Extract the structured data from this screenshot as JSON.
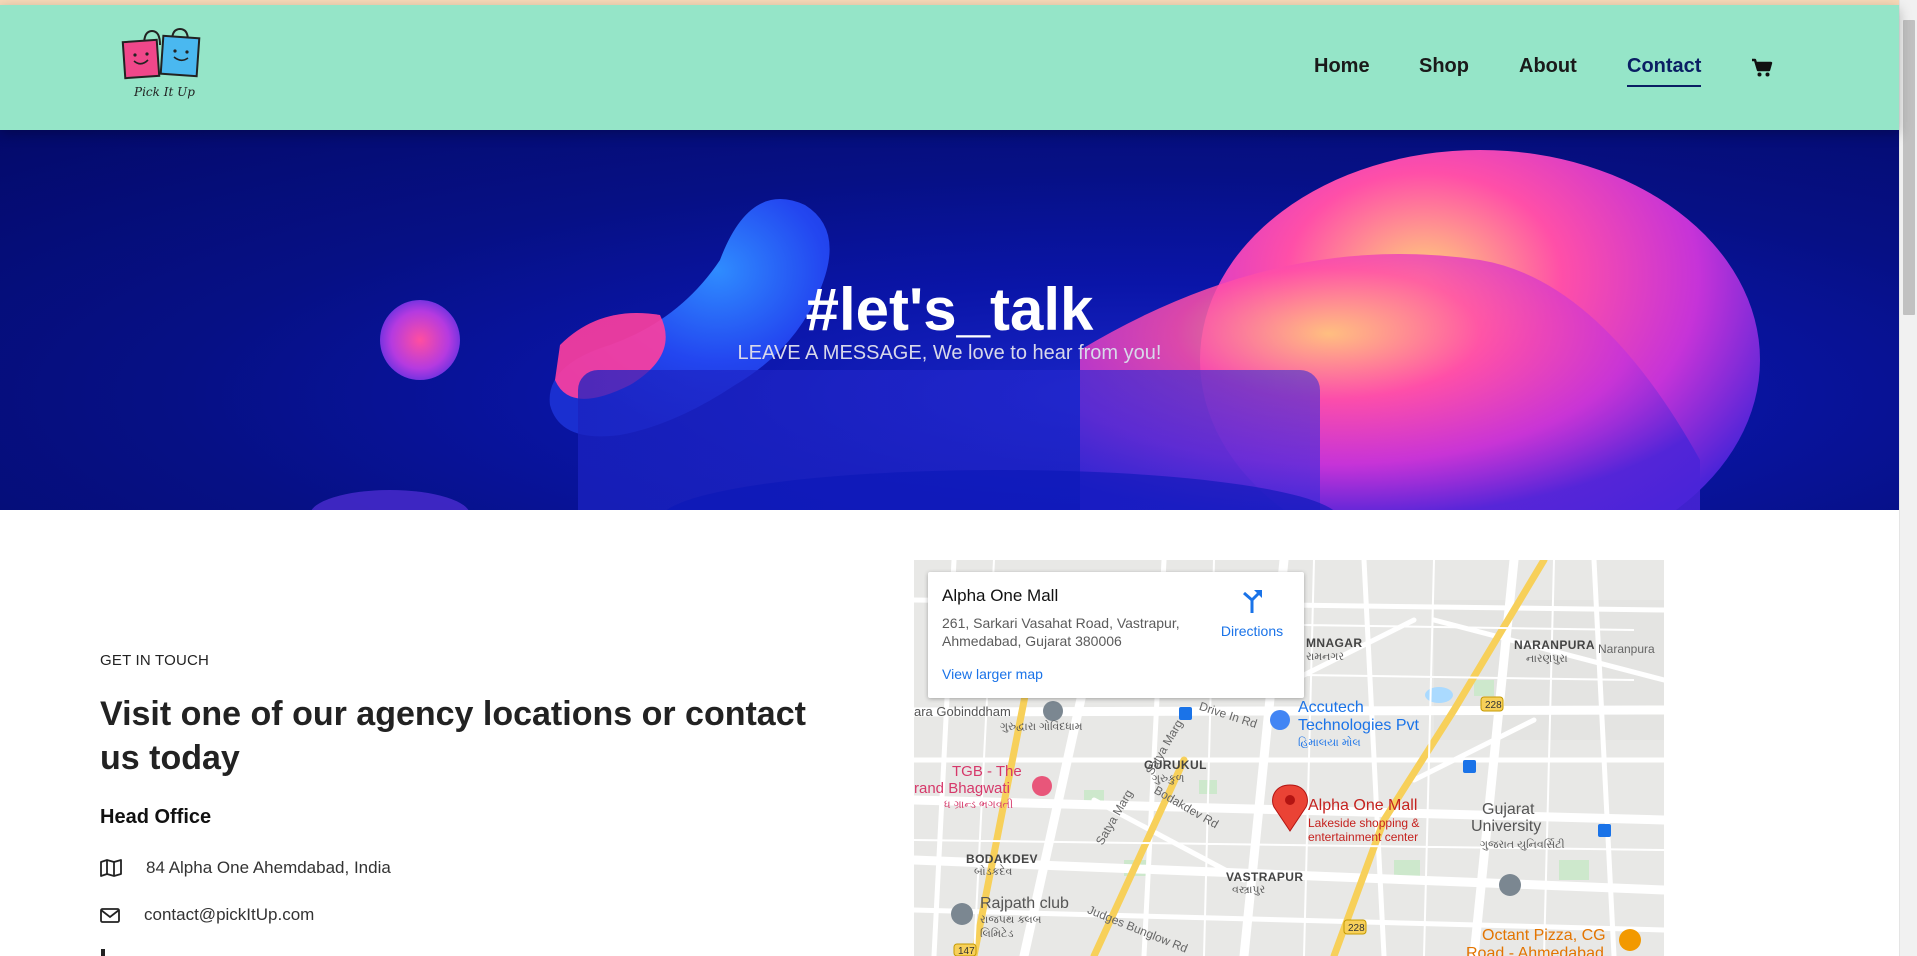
{
  "brand": {
    "logo_text": "Pick It Up"
  },
  "nav": {
    "items": [
      {
        "label": "Home",
        "active": false
      },
      {
        "label": "Shop",
        "active": false
      },
      {
        "label": "About",
        "active": false
      },
      {
        "label": "Contact",
        "active": true
      }
    ],
    "cart_icon": "cart-icon"
  },
  "hero": {
    "title": "#let's_talk",
    "subtitle": "LEAVE A MESSAGE, We love to hear from you!"
  },
  "contact": {
    "section_label": "GET IN TOUCH",
    "heading": "Visit one of our agency locations or contact us today",
    "office_heading": "Head Office",
    "address": "84 Alpha One Ahemdabad, India",
    "email": "contact@pickItUp.com"
  },
  "map": {
    "card": {
      "title": "Alpha One Mall",
      "address": "261, Sarkari Vasahat Road, Vastrapur, Ahmedabad, Gujarat 380006",
      "directions_label": "Directions",
      "larger_map_label": "View larger map"
    },
    "labels": {
      "gobinddham": "ara Gobinddham",
      "gobinddham_gu": "ગુરુદ્વારા ગોવિંદધામ",
      "accutech": "Accutech",
      "accutech2": "Technologies Pvt",
      "himalaya_gu": "હિમાલયા મોલ",
      "tgb": "TGB - The",
      "tgb2": "rand Bhagwati",
      "tgb_gu": "ધ ગ્રાન્ડ ભગવતી",
      "gurukul": "GURUKUL",
      "gurukul_gu": "ગુરુકુળ",
      "alpha": "Alpha One Mall",
      "alpha_sub": "Lakeside shopping &",
      "alpha_sub2": "entertainment center",
      "gujarat_univ": "Gujarat",
      "gujarat_univ2": "University",
      "gujarat_univ_gu": "ગુજરાત યુનિવર્સિટી",
      "bodakdev": "BODAKDEV",
      "bodakdev_gu": "બોડકદેવ",
      "vastrapur": "VASTRAPUR",
      "vastrapur_gu": "વસ્ત્રાપુર",
      "rajpath": "Rajpath club",
      "rajpath_gu": "રાજપથ ક્લબ",
      "rajpath_gu2": "લિમિટેડ",
      "octant": "Octant Pizza, CG",
      "octant2": "Road - Ahmedabad",
      "naranpura": "NARANPURA",
      "naranpura_gu": "નારણપુરા",
      "naranpura2": "Naranpura",
      "mnagar": "MNAGAR",
      "mnagar_gu": "રામનગર",
      "drive_in": "Drive In Rd",
      "satya_marg": "Satya Marg",
      "satya_marg2": "Satya Marg",
      "bodakdev_rd": "Bodakdev Rd",
      "judges": "Judges Bunglow Rd",
      "route_228a": "228",
      "route_228b": "228",
      "route_147": "147"
    }
  },
  "colors": {
    "header_bg": "#95e5c8",
    "active_nav": "#0a1e63",
    "hero_bg": "#061085",
    "map_link": "#1a73e8",
    "map_pin": "#ea4335"
  }
}
